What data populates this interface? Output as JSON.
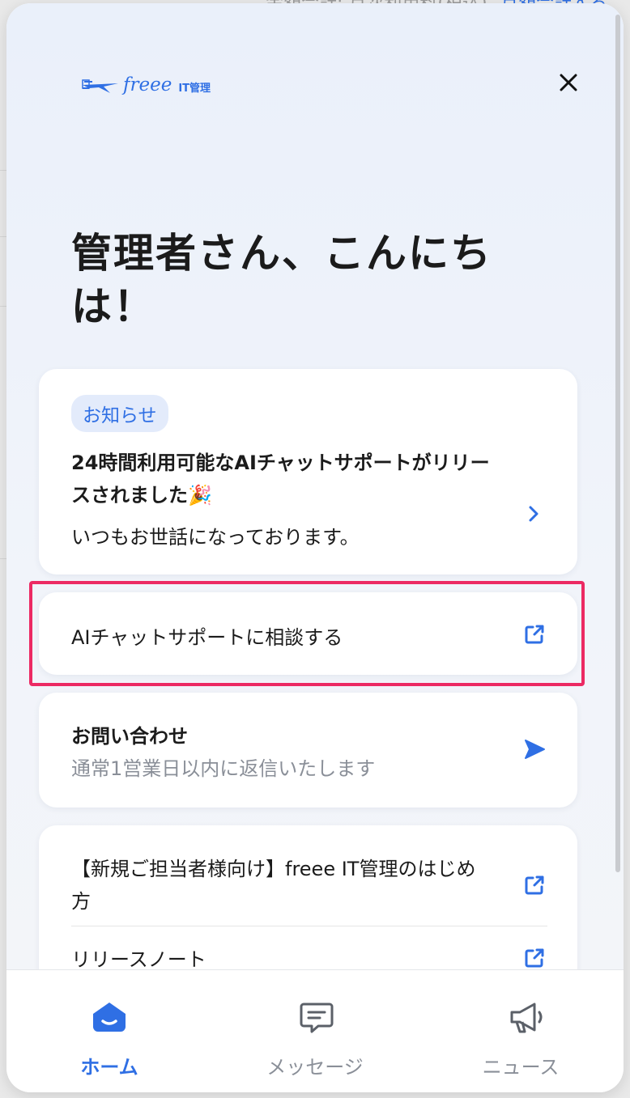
{
  "background": {
    "top_text_gray": "金額合計: 月次利用料(税込)",
    "top_text_blue": "月額合計する"
  },
  "logo": {
    "brand": "freee",
    "product": "IT管理"
  },
  "greeting": "管理者さん、こんにちは！",
  "news_card": {
    "badge": "お知らせ",
    "title": "24時間利用可能なAIチャットサポートがリリースされました🎉",
    "body": "いつもお世話になっております。"
  },
  "ai_card": {
    "label": "AIチャットサポートに相談する"
  },
  "contact_card": {
    "title": "お問い合わせ",
    "subtitle": "通常1営業日以内に返信いたします"
  },
  "links_card": {
    "items": [
      {
        "label": "【新規ご担当者様向け】freee IT管理のはじめ方"
      },
      {
        "label": "リリースノート"
      }
    ]
  },
  "tabs": [
    {
      "label": "ホーム",
      "icon": "home-icon",
      "active": true
    },
    {
      "label": "メッセージ",
      "icon": "message-icon",
      "active": false
    },
    {
      "label": "ニュース",
      "icon": "megaphone-icon",
      "active": false
    }
  ],
  "colors": {
    "accent": "#2f6fe4",
    "highlight": "#ec2a63",
    "text": "#1b1b1b",
    "muted": "#8a8f98"
  }
}
